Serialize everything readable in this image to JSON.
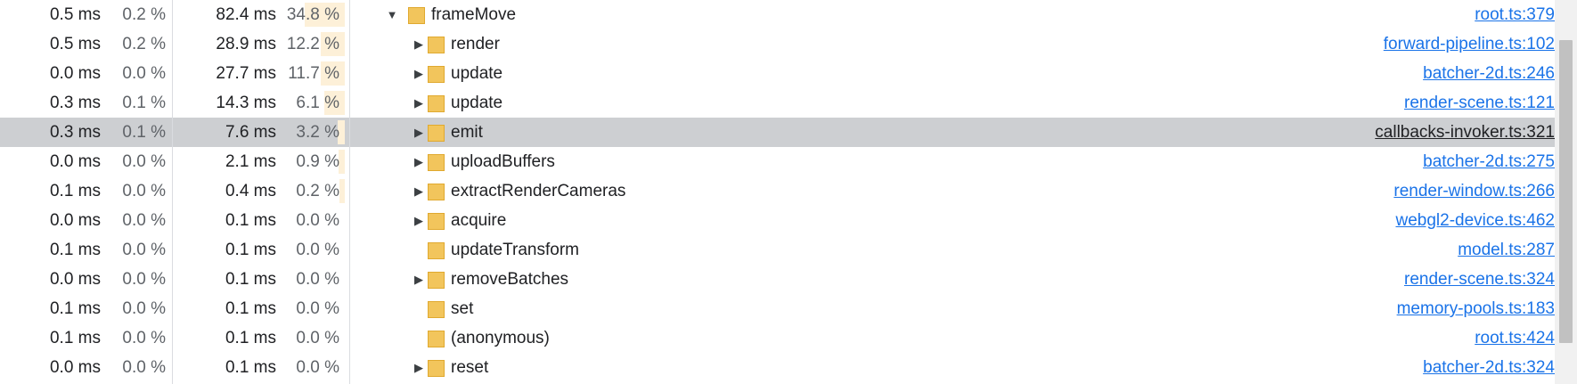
{
  "profile": {
    "rows": [
      {
        "self_time": "0.5 ms",
        "self_pct": "0.2 %",
        "total_time": "82.4 ms",
        "total_pct": "34.8 %",
        "total_fraction": 0.348,
        "name": "frameMove",
        "source": "root.ts:379",
        "depth": 0,
        "toggle": "expanded",
        "selected": false
      },
      {
        "self_time": "0.5 ms",
        "self_pct": "0.2 %",
        "total_time": "28.9 ms",
        "total_pct": "12.2 %",
        "total_fraction": 0.122,
        "name": "render",
        "source": "forward-pipeline.ts:102",
        "depth": 1,
        "toggle": "collapsed",
        "selected": false
      },
      {
        "self_time": "0.0 ms",
        "self_pct": "0.0 %",
        "total_time": "27.7 ms",
        "total_pct": "11.7 %",
        "total_fraction": 0.117,
        "name": "update",
        "source": "batcher-2d.ts:246",
        "depth": 1,
        "toggle": "collapsed",
        "selected": false
      },
      {
        "self_time": "0.3 ms",
        "self_pct": "0.1 %",
        "total_time": "14.3 ms",
        "total_pct": "6.1 %",
        "total_fraction": 0.061,
        "name": "update",
        "source": "render-scene.ts:121",
        "depth": 1,
        "toggle": "collapsed",
        "selected": false
      },
      {
        "self_time": "0.3 ms",
        "self_pct": "0.1 %",
        "total_time": "7.6 ms",
        "total_pct": "3.2 %",
        "total_fraction": 0.032,
        "name": "emit",
        "source": "callbacks-invoker.ts:321",
        "depth": 1,
        "toggle": "collapsed",
        "selected": true
      },
      {
        "self_time": "0.0 ms",
        "self_pct": "0.0 %",
        "total_time": "2.1 ms",
        "total_pct": "0.9 %",
        "total_fraction": 0.009,
        "name": "uploadBuffers",
        "source": "batcher-2d.ts:275",
        "depth": 1,
        "toggle": "collapsed",
        "selected": false
      },
      {
        "self_time": "0.1 ms",
        "self_pct": "0.0 %",
        "total_time": "0.4 ms",
        "total_pct": "0.2 %",
        "total_fraction": 0.002,
        "name": "extractRenderCameras",
        "source": "render-window.ts:266",
        "depth": 1,
        "toggle": "collapsed",
        "selected": false
      },
      {
        "self_time": "0.0 ms",
        "self_pct": "0.0 %",
        "total_time": "0.1 ms",
        "total_pct": "0.0 %",
        "total_fraction": 0.0,
        "name": "acquire",
        "source": "webgl2-device.ts:462",
        "depth": 1,
        "toggle": "collapsed",
        "selected": false
      },
      {
        "self_time": "0.1 ms",
        "self_pct": "0.0 %",
        "total_time": "0.1 ms",
        "total_pct": "0.0 %",
        "total_fraction": 0.0,
        "name": "updateTransform",
        "source": "model.ts:287",
        "depth": 1,
        "toggle": "none",
        "selected": false
      },
      {
        "self_time": "0.0 ms",
        "self_pct": "0.0 %",
        "total_time": "0.1 ms",
        "total_pct": "0.0 %",
        "total_fraction": 0.0,
        "name": "removeBatches",
        "source": "render-scene.ts:324",
        "depth": 1,
        "toggle": "collapsed",
        "selected": false
      },
      {
        "self_time": "0.1 ms",
        "self_pct": "0.0 %",
        "total_time": "0.1 ms",
        "total_pct": "0.0 %",
        "total_fraction": 0.0,
        "name": "set",
        "source": "memory-pools.ts:183",
        "depth": 1,
        "toggle": "none",
        "selected": false
      },
      {
        "self_time": "0.1 ms",
        "self_pct": "0.0 %",
        "total_time": "0.1 ms",
        "total_pct": "0.0 %",
        "total_fraction": 0.0,
        "name": "(anonymous)",
        "source": "root.ts:424",
        "depth": 1,
        "toggle": "none",
        "selected": false
      },
      {
        "self_time": "0.0 ms",
        "self_pct": "0.0 %",
        "total_time": "0.1 ms",
        "total_pct": "0.0 %",
        "total_fraction": 0.0,
        "name": "reset",
        "source": "batcher-2d.ts:324",
        "depth": 1,
        "toggle": "collapsed",
        "selected": false
      }
    ]
  },
  "icons": {
    "expanded": "triangle-down-icon",
    "collapsed": "triangle-right-icon",
    "function": "function-swatch-icon"
  },
  "colors": {
    "swatch": "#f2c55c",
    "link": "#1a73e8",
    "selected_row": "#cdcfd2",
    "total_bar": "#fdf0d8"
  }
}
